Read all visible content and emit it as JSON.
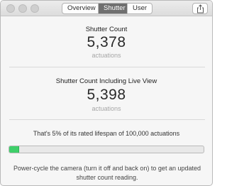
{
  "window": {
    "tabs": [
      {
        "label": "Overview",
        "active": false
      },
      {
        "label": "Shutter",
        "active": true
      },
      {
        "label": "User",
        "active": false
      }
    ],
    "share_icon": "share-icon"
  },
  "shutter_count": {
    "title": "Shutter Count",
    "value": "5,378",
    "unit": "actuations"
  },
  "shutter_count_live_view": {
    "title": "Shutter Count Including Live View",
    "value": "5,398",
    "unit": "actuations"
  },
  "lifespan": {
    "text": "That's 5% of its rated lifespan of 100,000 actuations",
    "percent": 5,
    "bar_color": "#3fcf6a"
  },
  "footnote": "Power-cycle the camera (turn it off and back on) to get an updated shutter count reading."
}
